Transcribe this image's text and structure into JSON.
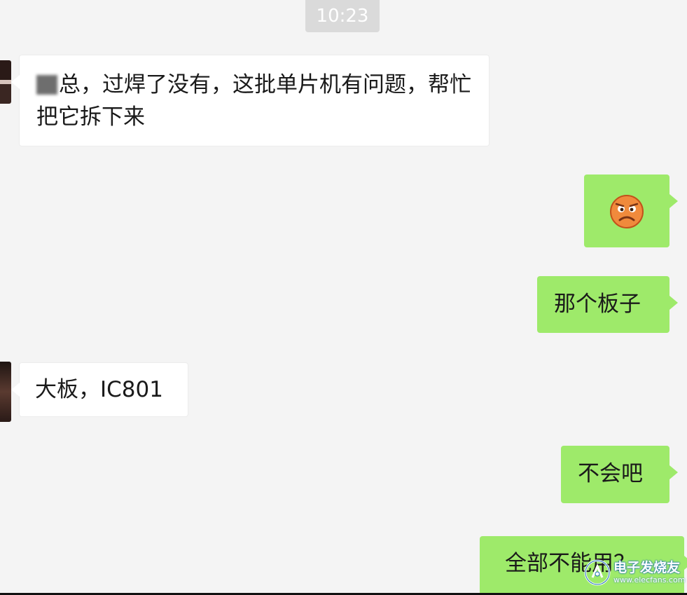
{
  "time": "10:23",
  "messages": [
    {
      "side": "left",
      "text": "总，过焊了没有，这批单片机有问题，帮忙把它拆下来"
    },
    {
      "side": "right",
      "emoji": "sad-face-emoji"
    },
    {
      "side": "right",
      "text": "那个板子"
    },
    {
      "side": "left",
      "text": "大板，IC801"
    },
    {
      "side": "right",
      "text": "不会吧"
    },
    {
      "side": "right",
      "text": "全部不能用？"
    }
  ],
  "watermark": {
    "title": "电子发烧友",
    "url": "www.elecfans.com",
    "icon": "elecfans-logo"
  },
  "colors": {
    "right_bubble": "#9eea6a",
    "left_bubble": "#ffffff",
    "background": "#f4f4f4",
    "time_badge": "#dadada"
  }
}
